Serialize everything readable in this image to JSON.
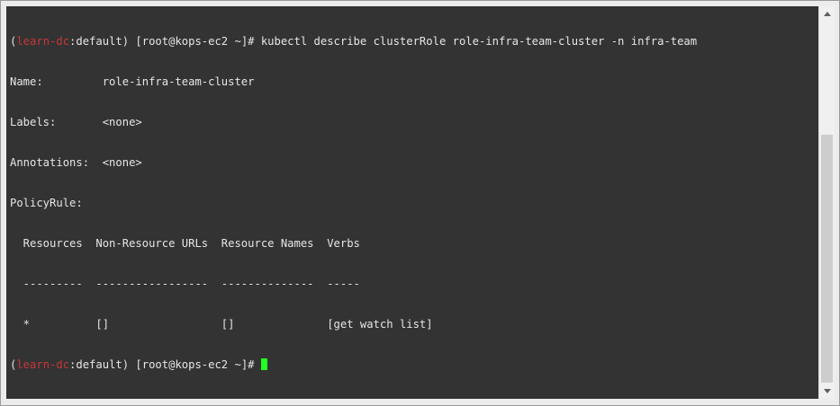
{
  "terminal": {
    "lines": [
      {
        "p1": "(",
        "context": "learn-dc",
        "p2": ":default) [root@kops-ec2 ~]# kubectl describe clusterRole role-infra-team-cluster -n infra-team"
      },
      {
        "text": "Name:         role-infra-team-cluster"
      },
      {
        "text": "Labels:       <none>"
      },
      {
        "text": "Annotations:  <none>"
      },
      {
        "text": "PolicyRule:"
      },
      {
        "text": "  Resources  Non-Resource URLs  Resource Names  Verbs"
      },
      {
        "text": "  ---------  -----------------  --------------  -----"
      },
      {
        "text": "  *          []                 []              [get watch list]"
      },
      {
        "p1": "(",
        "context": "learn-dc",
        "p2": ":default) [root@kops-ec2 ~]# "
      }
    ]
  },
  "colors": {
    "background": "#333333",
    "foreground": "#e6e6e6",
    "context": "#c8363a",
    "cursor": "#22ff22"
  },
  "icons": {
    "scroll_up": "triangle-up-icon",
    "scroll_down": "triangle-down-icon"
  }
}
